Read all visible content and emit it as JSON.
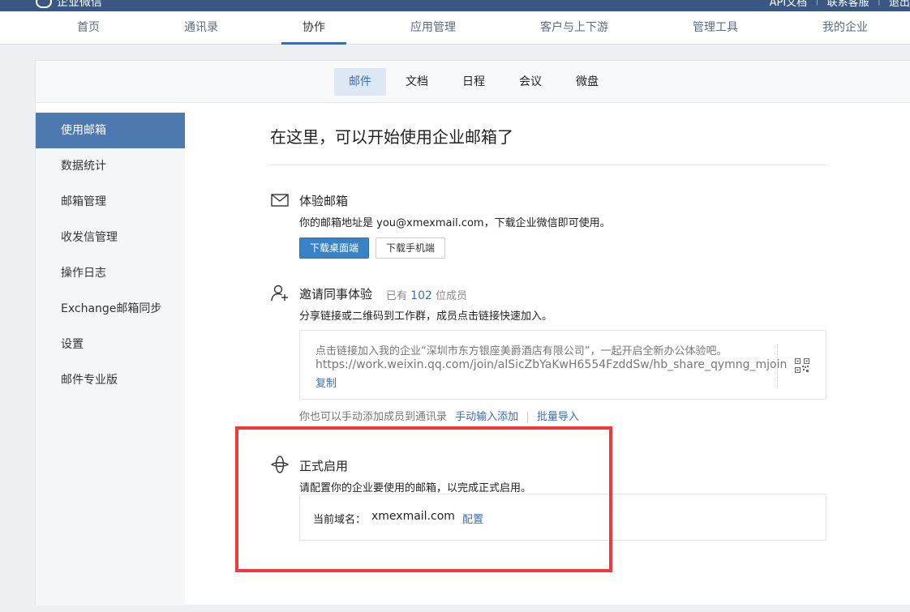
{
  "topbar": {
    "brand": "企业微信",
    "links": [
      "API文档",
      "联系客服",
      "退出"
    ]
  },
  "mainnav": {
    "items": [
      "首页",
      "通讯录",
      "协作",
      "应用管理",
      "客户与上下游",
      "管理工具",
      "我的企业"
    ],
    "active": "协作"
  },
  "subtabs": {
    "items": [
      "邮件",
      "文档",
      "日程",
      "会议",
      "微盘"
    ],
    "active": "邮件"
  },
  "sidebar": {
    "items": [
      "使用邮箱",
      "数据统计",
      "邮箱管理",
      "收发信管理",
      "操作日志",
      "Exchange邮箱同步",
      "设置",
      "邮件专业版"
    ],
    "active": "使用邮箱"
  },
  "content": {
    "title": "在这里，可以开始使用企业邮箱了",
    "trial": {
      "title": "体验邮箱",
      "desc": "你的邮箱地址是 you@xmexmail.com，下载企业微信即可使用。",
      "btn_desktop": "下载桌面端",
      "btn_mobile": "下载手机端"
    },
    "invite": {
      "title": "邀请同事体验",
      "count_prefix": "已有",
      "count": "102",
      "count_suffix": "位成员",
      "desc": "分享链接或二维码到工作群，成员点击链接快速加入。",
      "message": "点击链接加入我的企业“深圳市东方银座美爵酒店有限公司”，一起开启全新办公体验吧。",
      "url": "https://work.weixin.qq.com/join/alSicZbYaKwH6554FzddSw/hb_share_qymng_mjoin",
      "copy": "复制",
      "manual_text": "你也可以手动添加成员到通讯录",
      "manual_link1": "手动输入添加",
      "manual_link2": "批量导入"
    },
    "formal": {
      "title": "正式启用",
      "desc": "请配置你的企业要使用的邮箱，以完成正式启用。",
      "domain_label": "当前域名：",
      "domain_value": "xmexmail.com",
      "config": "配置"
    }
  },
  "colors": {
    "topbar": "#39577f",
    "accent": "#3d6ea8",
    "sidebar_active": "#4d79b0",
    "highlight": "#ee3a3c"
  }
}
